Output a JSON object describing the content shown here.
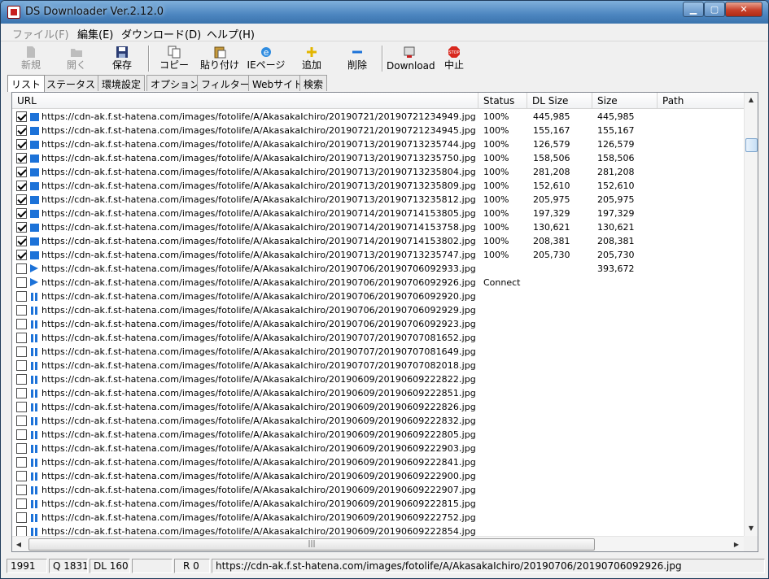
{
  "window": {
    "title": "DS Downloader Ver.2.12.0"
  },
  "menu": [
    {
      "label": "ファイル(F)",
      "disabled": true
    },
    {
      "label": "編集(E)"
    },
    {
      "label": "ダウンロード(D)"
    },
    {
      "label": "ヘルプ(H)"
    }
  ],
  "toolbar": {
    "new": "新規",
    "open": "開く",
    "save": "保存",
    "copy": "コピー",
    "paste": "貼り付け",
    "iepage": "IEページ",
    "add": "追加",
    "delete": "削除",
    "download": "Download",
    "stop": "中止"
  },
  "tabs": [
    "リスト",
    "ステータス",
    "環境設定",
    "オプション",
    "フィルター",
    "Webサイト",
    "検索"
  ],
  "columns": {
    "url": "URL",
    "status": "Status",
    "dl_size": "DL Size",
    "size": "Size",
    "path": "Path"
  },
  "rows": [
    {
      "checked": true,
      "state": "done",
      "url": "https://cdn-ak.f.st-hatena.com/images/fotolife/A/AkasakaIchiro/20190721/20190721234949.jpg",
      "status": "100%",
      "dl": "445,985",
      "size": "445,985"
    },
    {
      "checked": true,
      "state": "done",
      "url": "https://cdn-ak.f.st-hatena.com/images/fotolife/A/AkasakaIchiro/20190721/20190721234945.jpg",
      "status": "100%",
      "dl": "155,167",
      "size": "155,167"
    },
    {
      "checked": true,
      "state": "done",
      "url": "https://cdn-ak.f.st-hatena.com/images/fotolife/A/AkasakaIchiro/20190713/20190713235744.jpg",
      "status": "100%",
      "dl": "126,579",
      "size": "126,579"
    },
    {
      "checked": true,
      "state": "done",
      "url": "https://cdn-ak.f.st-hatena.com/images/fotolife/A/AkasakaIchiro/20190713/20190713235750.jpg",
      "status": "100%",
      "dl": "158,506",
      "size": "158,506"
    },
    {
      "checked": true,
      "state": "done",
      "url": "https://cdn-ak.f.st-hatena.com/images/fotolife/A/AkasakaIchiro/20190713/20190713235804.jpg",
      "status": "100%",
      "dl": "281,208",
      "size": "281,208"
    },
    {
      "checked": true,
      "state": "done",
      "url": "https://cdn-ak.f.st-hatena.com/images/fotolife/A/AkasakaIchiro/20190713/20190713235809.jpg",
      "status": "100%",
      "dl": "152,610",
      "size": "152,610"
    },
    {
      "checked": true,
      "state": "done",
      "url": "https://cdn-ak.f.st-hatena.com/images/fotolife/A/AkasakaIchiro/20190713/20190713235812.jpg",
      "status": "100%",
      "dl": "205,975",
      "size": "205,975"
    },
    {
      "checked": true,
      "state": "done",
      "url": "https://cdn-ak.f.st-hatena.com/images/fotolife/A/AkasakaIchiro/20190714/20190714153805.jpg",
      "status": "100%",
      "dl": "197,329",
      "size": "197,329"
    },
    {
      "checked": true,
      "state": "done",
      "url": "https://cdn-ak.f.st-hatena.com/images/fotolife/A/AkasakaIchiro/20190714/20190714153758.jpg",
      "status": "100%",
      "dl": "130,621",
      "size": "130,621"
    },
    {
      "checked": true,
      "state": "done",
      "url": "https://cdn-ak.f.st-hatena.com/images/fotolife/A/AkasakaIchiro/20190714/20190714153802.jpg",
      "status": "100%",
      "dl": "208,381",
      "size": "208,381"
    },
    {
      "checked": true,
      "state": "done",
      "url": "https://cdn-ak.f.st-hatena.com/images/fotolife/A/AkasakaIchiro/20190713/20190713235747.jpg",
      "status": "100%",
      "dl": "205,730",
      "size": "205,730"
    },
    {
      "checked": false,
      "state": "play",
      "url": "https://cdn-ak.f.st-hatena.com/images/fotolife/A/AkasakaIchiro/20190706/20190706092933.jpg",
      "status": "",
      "dl": "",
      "size": "393,672"
    },
    {
      "checked": false,
      "state": "play",
      "url": "https://cdn-ak.f.st-hatena.com/images/fotolife/A/AkasakaIchiro/20190706/20190706092926.jpg",
      "status": "Connect",
      "dl": "",
      "size": ""
    },
    {
      "checked": false,
      "state": "pause",
      "url": "https://cdn-ak.f.st-hatena.com/images/fotolife/A/AkasakaIchiro/20190706/20190706092920.jpg",
      "status": "",
      "dl": "",
      "size": ""
    },
    {
      "checked": false,
      "state": "pause",
      "url": "https://cdn-ak.f.st-hatena.com/images/fotolife/A/AkasakaIchiro/20190706/20190706092929.jpg",
      "status": "",
      "dl": "",
      "size": ""
    },
    {
      "checked": false,
      "state": "pause",
      "url": "https://cdn-ak.f.st-hatena.com/images/fotolife/A/AkasakaIchiro/20190706/20190706092923.jpg",
      "status": "",
      "dl": "",
      "size": ""
    },
    {
      "checked": false,
      "state": "pause",
      "url": "https://cdn-ak.f.st-hatena.com/images/fotolife/A/AkasakaIchiro/20190707/20190707081652.jpg",
      "status": "",
      "dl": "",
      "size": ""
    },
    {
      "checked": false,
      "state": "pause",
      "url": "https://cdn-ak.f.st-hatena.com/images/fotolife/A/AkasakaIchiro/20190707/20190707081649.jpg",
      "status": "",
      "dl": "",
      "size": ""
    },
    {
      "checked": false,
      "state": "pause",
      "url": "https://cdn-ak.f.st-hatena.com/images/fotolife/A/AkasakaIchiro/20190707/20190707082018.jpg",
      "status": "",
      "dl": "",
      "size": ""
    },
    {
      "checked": false,
      "state": "pause",
      "url": "https://cdn-ak.f.st-hatena.com/images/fotolife/A/AkasakaIchiro/20190609/20190609222822.jpg",
      "status": "",
      "dl": "",
      "size": ""
    },
    {
      "checked": false,
      "state": "pause",
      "url": "https://cdn-ak.f.st-hatena.com/images/fotolife/A/AkasakaIchiro/20190609/20190609222851.jpg",
      "status": "",
      "dl": "",
      "size": ""
    },
    {
      "checked": false,
      "state": "pause",
      "url": "https://cdn-ak.f.st-hatena.com/images/fotolife/A/AkasakaIchiro/20190609/20190609222826.jpg",
      "status": "",
      "dl": "",
      "size": ""
    },
    {
      "checked": false,
      "state": "pause",
      "url": "https://cdn-ak.f.st-hatena.com/images/fotolife/A/AkasakaIchiro/20190609/20190609222832.jpg",
      "status": "",
      "dl": "",
      "size": ""
    },
    {
      "checked": false,
      "state": "pause",
      "url": "https://cdn-ak.f.st-hatena.com/images/fotolife/A/AkasakaIchiro/20190609/20190609222805.jpg",
      "status": "",
      "dl": "",
      "size": ""
    },
    {
      "checked": false,
      "state": "pause",
      "url": "https://cdn-ak.f.st-hatena.com/images/fotolife/A/AkasakaIchiro/20190609/20190609222903.jpg",
      "status": "",
      "dl": "",
      "size": ""
    },
    {
      "checked": false,
      "state": "pause",
      "url": "https://cdn-ak.f.st-hatena.com/images/fotolife/A/AkasakaIchiro/20190609/20190609222841.jpg",
      "status": "",
      "dl": "",
      "size": ""
    },
    {
      "checked": false,
      "state": "pause",
      "url": "https://cdn-ak.f.st-hatena.com/images/fotolife/A/AkasakaIchiro/20190609/20190609222900.jpg",
      "status": "",
      "dl": "",
      "size": ""
    },
    {
      "checked": false,
      "state": "pause",
      "url": "https://cdn-ak.f.st-hatena.com/images/fotolife/A/AkasakaIchiro/20190609/20190609222907.jpg",
      "status": "",
      "dl": "",
      "size": ""
    },
    {
      "checked": false,
      "state": "pause",
      "url": "https://cdn-ak.f.st-hatena.com/images/fotolife/A/AkasakaIchiro/20190609/20190609222815.jpg",
      "status": "",
      "dl": "",
      "size": ""
    },
    {
      "checked": false,
      "state": "pause",
      "url": "https://cdn-ak.f.st-hatena.com/images/fotolife/A/AkasakaIchiro/20190609/20190609222752.jpg",
      "status": "",
      "dl": "",
      "size": ""
    },
    {
      "checked": false,
      "state": "pause",
      "url": "https://cdn-ak.f.st-hatena.com/images/fotolife/A/AkasakaIchiro/20190609/20190609222854.jpg",
      "status": "",
      "dl": "",
      "size": ""
    }
  ],
  "statusbar": {
    "total": "1991",
    "queue": "Q 1831",
    "dl": "DL 160",
    "blank": "",
    "retry": "R 0",
    "current_url": "https://cdn-ak.f.st-hatena.com/images/fotolife/A/AkasakaIchiro/20190706/20190706092926.jpg"
  },
  "icons": {
    "app": "download-app-icon",
    "new": "new-file-icon",
    "open": "open-folder-icon",
    "save": "floppy-disk-icon",
    "copy": "copy-icon",
    "paste": "paste-icon",
    "iepage": "ie-icon",
    "add": "plus-icon",
    "delete": "minus-icon",
    "download": "download-icon",
    "stop": "stop-icon",
    "done_state": "blue-square-icon",
    "play_state": "play-icon",
    "pause_state": "pause-icon"
  },
  "colors": {
    "accent_blue": "#1c72d8",
    "stop_red": "#d8281e",
    "add_yellow": "#e3b600"
  }
}
